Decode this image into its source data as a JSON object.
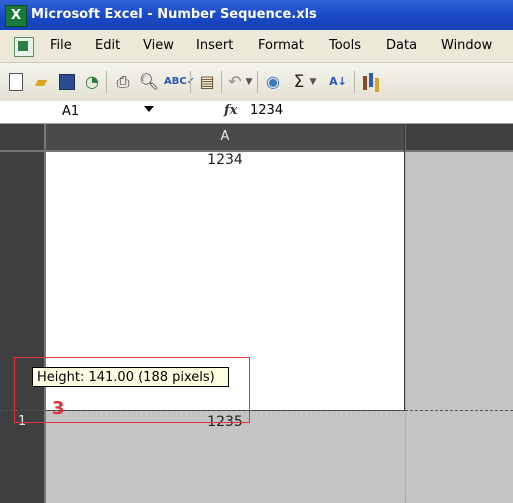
{
  "window": {
    "title": "Microsoft Excel - Number Sequence.xls",
    "app_icon": "excel-icon"
  },
  "menu": {
    "items": [
      "File",
      "Edit",
      "View",
      "Insert",
      "Format",
      "Tools",
      "Data",
      "Window"
    ]
  },
  "toolbar": {
    "icons": [
      "new-icon",
      "open-icon",
      "save-icon",
      "permission-icon",
      "print-icon",
      "print-preview-icon",
      "spelling-icon",
      "paste-icon",
      "undo-icon",
      "hyperlink-icon",
      "autosum-icon",
      "sort-ascending-icon",
      "chart-wizard-icon"
    ],
    "sum_symbol": "Σ",
    "sort_symbol": "A↓"
  },
  "formula_bar": {
    "name_box": "A1",
    "fx": "fx",
    "value": "1234"
  },
  "sheet": {
    "column_header": "A",
    "row_number": "1",
    "cell_a1": "1234",
    "cell_a2": "1235"
  },
  "tooltip": {
    "text": "Height: 141.00 (188 pixels)"
  },
  "annotation": {
    "step_number": "3",
    "color": "#e0343a"
  },
  "colors": {
    "titlebar": "#1a49c6",
    "menubar": "#ece9d8",
    "sheet_dark": "#3b3b3b",
    "tooltip_bg": "#ffffe1"
  }
}
